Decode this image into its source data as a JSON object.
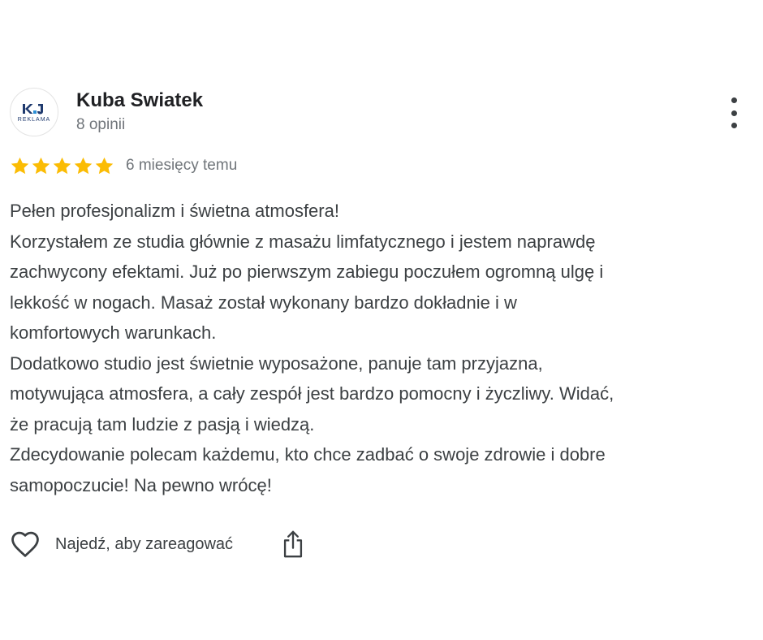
{
  "review": {
    "author": {
      "name": "Kuba Swiatek",
      "reviews_count": "8 opinii",
      "avatar": {
        "logo_text": "KJ",
        "caption": "REKLAMA",
        "brand_color": "#1f3a6e"
      }
    },
    "menu_icon": "more-vertical-icon",
    "rating": {
      "stars": 5,
      "max_stars": 5,
      "star_color": "#fbbc04",
      "time_ago": "6 miesięcy temu"
    },
    "text_lines": [
      "Pełen profesjonalizm i świetna atmosfera!",
      "Korzystałem ze studia głównie z masażu limfatycznego i jestem naprawdę",
      "zachwycony efektami. Już po pierwszym zabiegu poczułem ogromną ulgę i",
      "lekkość w nogach. Masaż został wykonany bardzo dokładnie i w",
      "komfortowych warunkach.",
      "Dodatkowo studio jest świetnie wyposażone, panuje tam przyjazna,",
      "motywująca atmosfera, a cały zespół jest bardzo pomocny i życzliwy. Widać,",
      "że pracują tam ludzie z pasją i wiedzą.",
      "Zdecydowanie polecam każdemu, kto chce zadbać o swoje zdrowie i dobre",
      "samopoczucie! Na pewno wrócę!"
    ],
    "actions": {
      "react_icon": "heart-outline-icon",
      "react_label": "Najedź, aby zareagować",
      "share_icon": "share-icon"
    }
  }
}
